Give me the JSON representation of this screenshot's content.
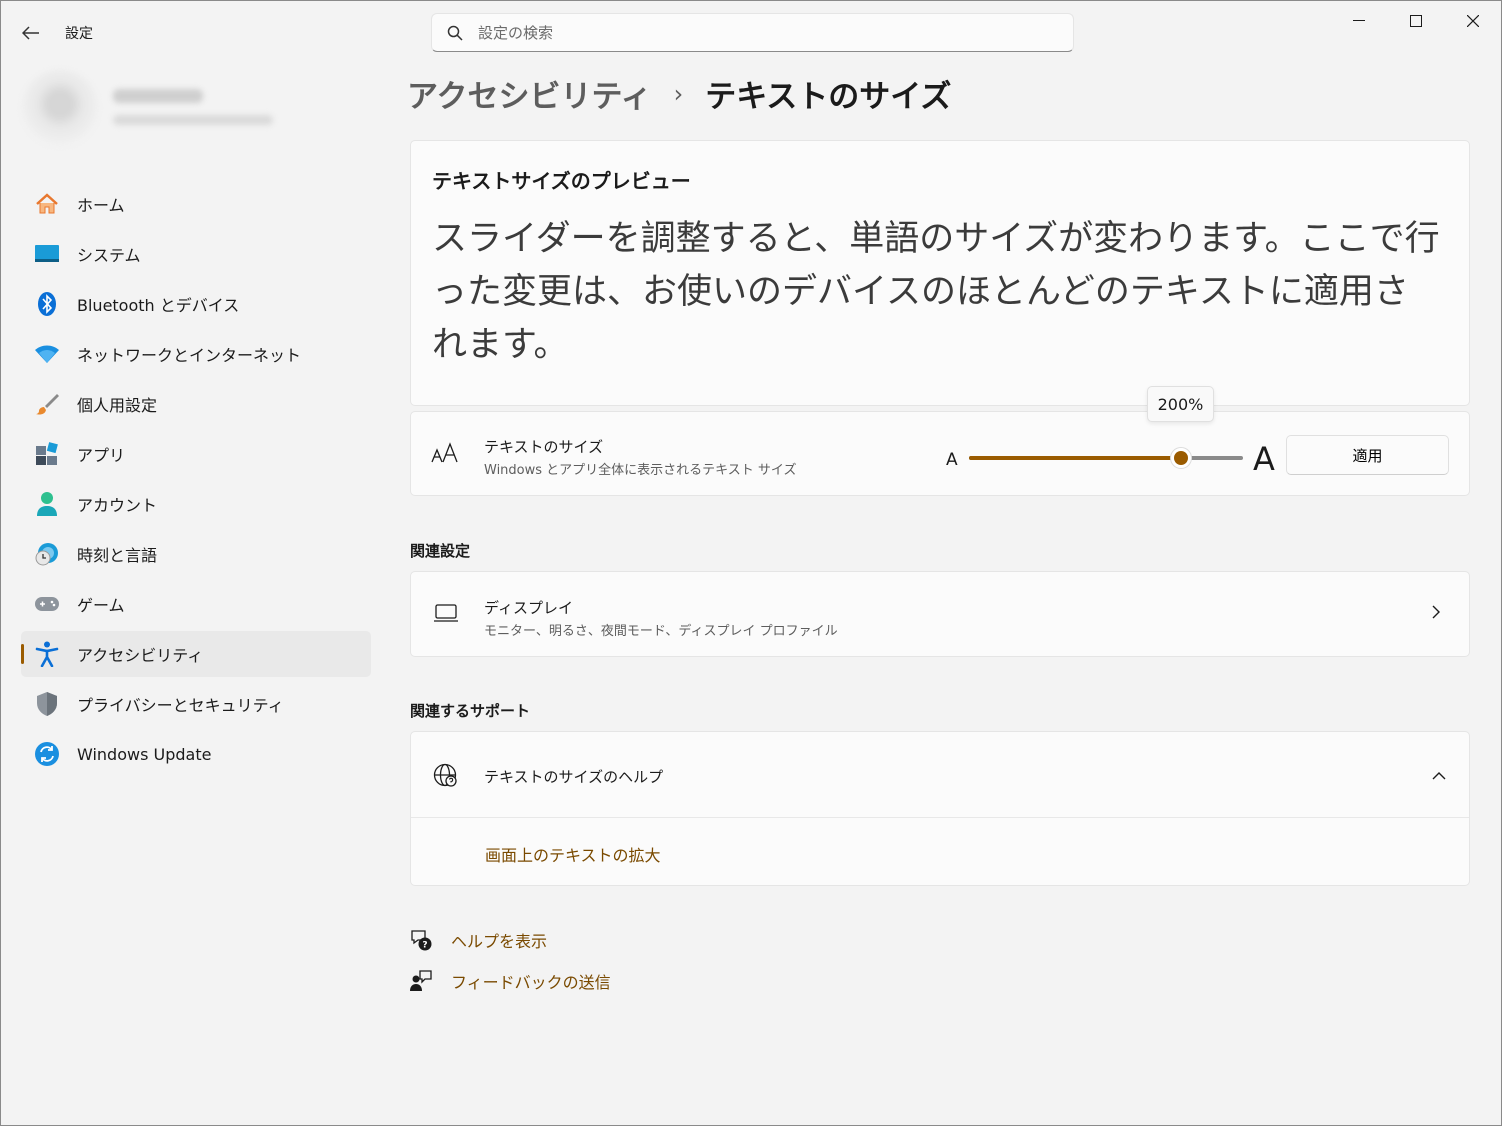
{
  "window": {
    "app_title": "設定",
    "search_placeholder": "設定の検索"
  },
  "sidebar": {
    "items": [
      {
        "label": "ホーム",
        "icon": "home-icon"
      },
      {
        "label": "システム",
        "icon": "system-icon"
      },
      {
        "label": "Bluetooth とデバイス",
        "icon": "bluetooth-icon"
      },
      {
        "label": "ネットワークとインターネット",
        "icon": "wifi-icon"
      },
      {
        "label": "個人用設定",
        "icon": "brush-icon"
      },
      {
        "label": "アプリ",
        "icon": "apps-icon"
      },
      {
        "label": "アカウント",
        "icon": "account-icon"
      },
      {
        "label": "時刻と言語",
        "icon": "time-language-icon"
      },
      {
        "label": "ゲーム",
        "icon": "gamepad-icon"
      },
      {
        "label": "アクセシビリティ",
        "icon": "accessibility-icon",
        "active": true
      },
      {
        "label": "プライバシーとセキュリティ",
        "icon": "shield-icon"
      },
      {
        "label": "Windows Update",
        "icon": "update-icon"
      }
    ]
  },
  "breadcrumb": {
    "parent": "アクセシビリティ",
    "separator": "›",
    "current": "テキストのサイズ"
  },
  "preview": {
    "title": "テキストサイズのプレビュー",
    "text": "スライダーを調整すると、単語のサイズが変わります。ここで行った変更は、お使いのデバイスのほとんどのテキストに適用されます。"
  },
  "text_size": {
    "title": "テキストのサイズ",
    "subtitle": "Windows とアプリ全体に表示されるテキスト サイズ",
    "small_a": "A",
    "large_a": "A",
    "slider_value": 0.775,
    "tooltip": "200%",
    "apply_label": "適用",
    "accent_color": "#9a5b00"
  },
  "related_settings": {
    "heading": "関連設定",
    "display": {
      "title": "ディスプレイ",
      "subtitle": "モニター、明るさ、夜間モード、ディスプレイ プロファイル"
    }
  },
  "related_support": {
    "heading": "関連するサポート",
    "help_title": "テキストのサイズのヘルプ",
    "link": "画面上のテキストの拡大"
  },
  "footer_links": {
    "help": "ヘルプを表示",
    "feedback": "フィードバックの送信"
  }
}
